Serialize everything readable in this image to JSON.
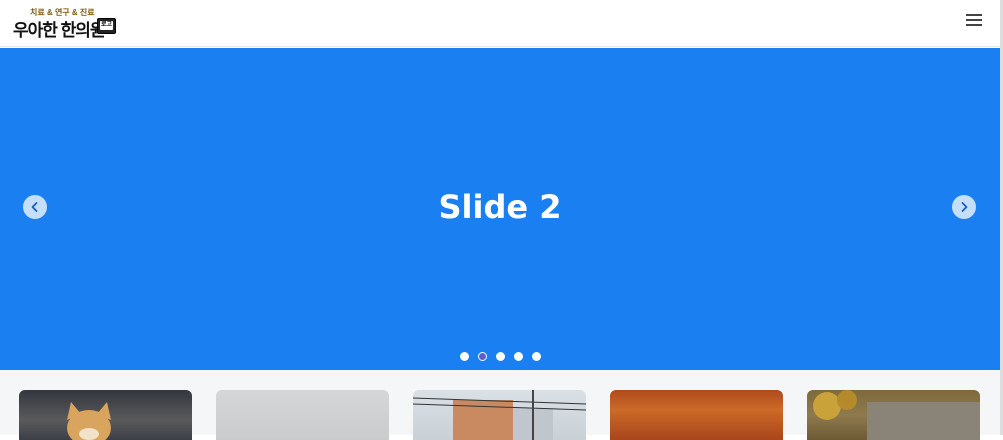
{
  "header": {
    "logo_tagline": "치료 & 연구 & 진료",
    "logo_text": "우아한 한의원",
    "logo_badge": "로고",
    "menu_icon": "hamburger-menu-icon"
  },
  "carousel": {
    "current_slide_title": "Slide 2",
    "slide_count": 5,
    "active_index": 1,
    "background_color": "#1a7ff0",
    "prev_icon": "chevron-left-icon",
    "next_icon": "chevron-right-icon"
  },
  "thumbnails": [
    {
      "name": "kitten",
      "color": "#4a4c52"
    },
    {
      "name": "overcast-sky",
      "color": "#cdd0d2"
    },
    {
      "name": "buildings-power-lines",
      "color": "#d1d8de"
    },
    {
      "name": "rust-texture",
      "color": "#c05a22"
    },
    {
      "name": "stone-wall-autumn",
      "color": "#85714a"
    }
  ]
}
